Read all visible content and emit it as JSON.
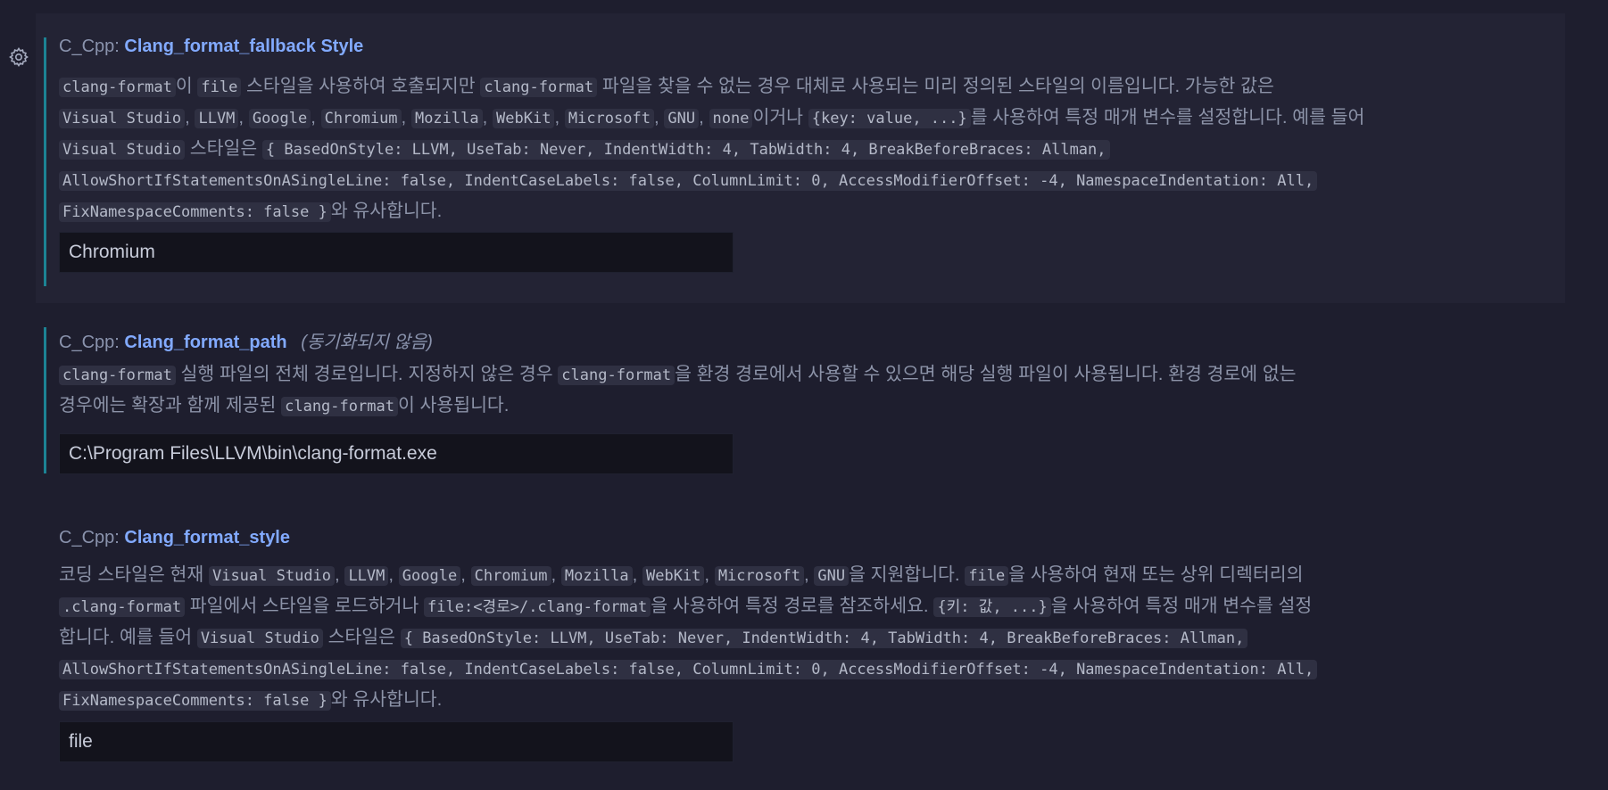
{
  "settings": [
    {
      "category": "C_Cpp:",
      "name": "Clang_format_fallback Style",
      "sync_note": "",
      "value": "Chromium",
      "desc": {
        "l1": {
          "c1": "clang-format",
          "t1": "이 ",
          "c2": "file",
          "t2": " 스타일을 사용하여 호출되지만 ",
          "c3": "clang-format",
          "t3": " 파일을 찾을 수 없는 경우 대체로 사용되는 미리 정의된 스타일의 이름입니다. 가능한 값은"
        },
        "l2": {
          "c1": "Visual Studio",
          "s1": ", ",
          "c2": "LLVM",
          "s2": ", ",
          "c3": "Google",
          "s3": ", ",
          "c4": "Chromium",
          "s4": ", ",
          "c5": "Mozilla",
          "s5": ", ",
          "c6": "WebKit",
          "s6": ", ",
          "c7": "Microsoft",
          "s7": ", ",
          "c8": "GNU",
          "s8": ", ",
          "c9": "none",
          "t1": "이거나 ",
          "c10": "{key: value, ...}",
          "t2": "를 사용하여 특정 매개 변수를 설정합니다. 예를 들어"
        },
        "l3": {
          "c1": "Visual Studio",
          "t1": " 스타일은 ",
          "c2": "{ BasedOnStyle: LLVM, UseTab: Never, IndentWidth: 4, TabWidth: 4, BreakBeforeBraces: Allman,"
        },
        "l4": {
          "c1": "AllowShortIfStatementsOnASingleLine: false, IndentCaseLabels: false, ColumnLimit: 0, AccessModifierOffset: -4, NamespaceIndentation: All,"
        },
        "l5": {
          "c1": "FixNamespaceComments: false }",
          "t1": "와 유사합니다."
        }
      }
    },
    {
      "category": "C_Cpp:",
      "name": "Clang_format_path",
      "sync_note": "(동기화되지 않음)",
      "value": "C:\\Program Files\\LLVM\\bin\\clang-format.exe",
      "desc": {
        "l1": {
          "c1": "clang-format",
          "t1": " 실행 파일의 전체 경로입니다. 지정하지 않은 경우 ",
          "c2": "clang-format",
          "t2": "을 환경 경로에서 사용할 수 있으면 해당 실행 파일이 사용됩니다. 환경 경로에 없는"
        },
        "l2": {
          "t1": "경우에는 확장과 함께 제공된 ",
          "c1": "clang-format",
          "t2": "이 사용됩니다."
        }
      }
    },
    {
      "category": "C_Cpp:",
      "name": "Clang_format_style",
      "sync_note": "",
      "value": "file",
      "desc": {
        "l1": {
          "t1": "코딩 스타일은 현재 ",
          "c1": "Visual Studio",
          "s1": ", ",
          "c2": "LLVM",
          "s2": ", ",
          "c3": "Google",
          "s3": ", ",
          "c4": "Chromium",
          "s4": ", ",
          "c5": "Mozilla",
          "s5": ", ",
          "c6": "WebKit",
          "s6": ", ",
          "c7": "Microsoft",
          "s7": ", ",
          "c8": "GNU",
          "t2": "을 지원합니다. ",
          "c9": "file",
          "t3": "을 사용하여 현재 또는 상위 디렉터리의"
        },
        "l2": {
          "c1": ".clang-format",
          "t1": " 파일에서 스타일을 로드하거나 ",
          "c2": "file:<경로>/.clang-format",
          "t2": "을 사용하여 특정 경로를 참조하세요. ",
          "c3": "{키: 값, ...}",
          "t3": "을 사용하여 특정 매개 변수를 설정"
        },
        "l3": {
          "t1": "합니다. 예를 들어 ",
          "c1": "Visual Studio",
          "t2": " 스타일은 ",
          "c2": "{ BasedOnStyle: LLVM, UseTab: Never, IndentWidth: 4, TabWidth: 4, BreakBeforeBraces: Allman,"
        },
        "l4": {
          "c1": "AllowShortIfStatementsOnASingleLine: false, IndentCaseLabels: false, ColumnLimit: 0, AccessModifierOffset: -4, NamespaceIndentation: All,"
        },
        "l5": {
          "c1": "FixNamespaceComments: false }",
          "t1": "와 유사합니다."
        }
      }
    }
  ],
  "colors": {
    "accent_bar": "#1c8394",
    "setting_name": "#82aaff",
    "background": "#1e1e2e",
    "focused_background": "#232334"
  },
  "icons": {
    "gear": "gear-icon"
  }
}
